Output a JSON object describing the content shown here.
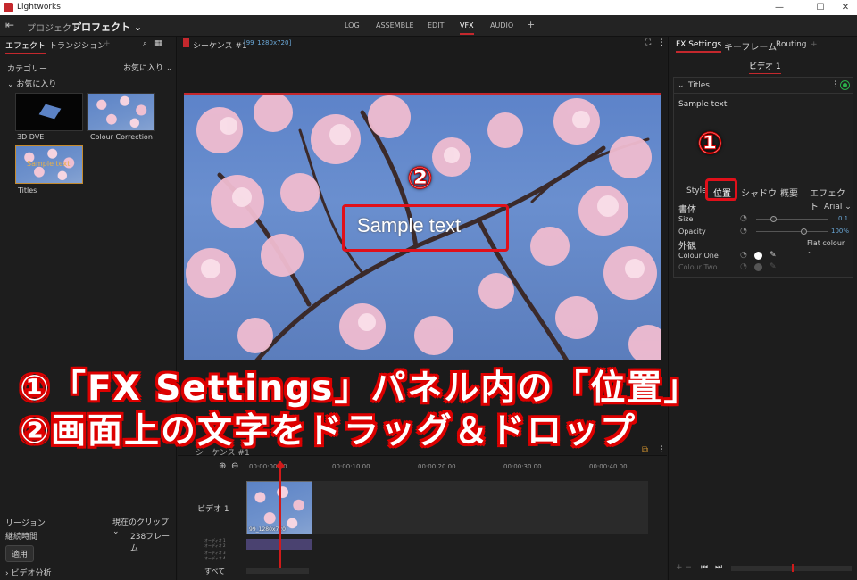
{
  "window": {
    "title": "Lightworks",
    "minimize": "—",
    "maximize": "☐",
    "close": "✕"
  },
  "menubar": {
    "project_label": "プロジェクト",
    "project_name": "プロフェクト",
    "tabs": [
      "LOG",
      "ASSEMBLE",
      "EDIT",
      "VFX",
      "AUDIO",
      "+"
    ],
    "active_tab": "VFX"
  },
  "left": {
    "tabs": [
      "エフェクト",
      "トランジション",
      "+"
    ],
    "category_label": "カテゴリー",
    "category_value": "お気に入り",
    "favorites_header": "お気に入り",
    "effects": [
      {
        "label": "3D DVE"
      },
      {
        "label": "Colour Correction"
      },
      {
        "label": "Titles"
      }
    ],
    "thumb_text": "Sample text",
    "region_label": "リージョン",
    "region_value": "現在のクリップ",
    "duration_label": "継続時間",
    "duration_value": "238フレーム",
    "apply_button": "適用",
    "video_analysis": "ビデオ分析"
  },
  "viewer": {
    "sequence_title": "シーケンス #1",
    "resolution": "[99_1280x720]",
    "sample_text": "Sample text"
  },
  "timeline": {
    "sequence_title": "シーケンス #1",
    "timecodes": [
      "00:00:00.00",
      "00:00:10.00",
      "00:00:20.00",
      "00:00:30.00",
      "00:00:40.00"
    ],
    "track_video": "ビデオ 1",
    "clip_label": "99_1280x720",
    "track_all": "すべて",
    "audio_tracks": [
      "オーディオ 1",
      "オーディオ 2",
      "オーディオ 3",
      "オーディオ 4"
    ]
  },
  "right": {
    "tabs": [
      "FX Settings",
      "キーフレーム",
      "Routing",
      "+"
    ],
    "video_label": "ビデオ 1",
    "effect_name": "Titles",
    "text_value": "Sample text",
    "subtabs": [
      "Style",
      "位置",
      "シャドウ",
      "概要",
      "エフェクト"
    ],
    "font_label": "書体",
    "font_value": "Arial",
    "size_label": "Size",
    "size_value": "0.1",
    "opacity_label": "Opacity",
    "opacity_value": "100%",
    "appearance_label": "外観",
    "appearance_value": "Flat colour",
    "colour_one": "Colour One",
    "colour_two": "Colour Two"
  },
  "annotations": {
    "num1": "①",
    "num2": "②",
    "line1": "①「FX Settings」パネル内の「位置」",
    "line2": "②画面上の文字をドラッグ＆ドロップ"
  },
  "colors": {
    "accent": "#c4282d",
    "annotation_red": "#e0101a",
    "panel": "#1d1d1d"
  }
}
